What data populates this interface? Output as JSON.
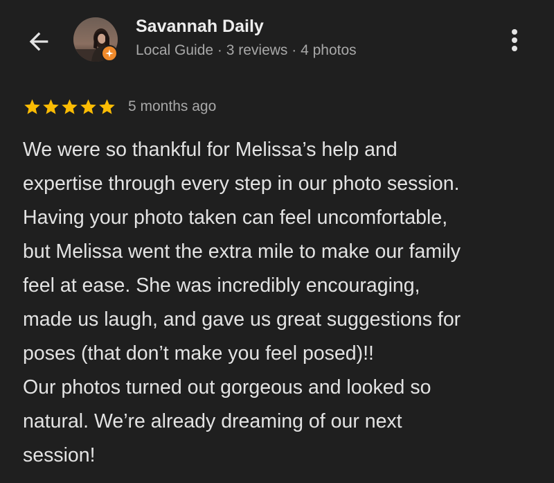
{
  "header": {
    "user_name": "Savannah Daily",
    "user_meta": "Local Guide · 3 reviews · 4 photos",
    "back_icon": "arrow-left-icon",
    "more_icon": "more-vertical-icon",
    "badge_icon": "local-guide-star-icon",
    "badge_color": "#f08a2b"
  },
  "review": {
    "rating": 5,
    "rating_max": 5,
    "star_color": "#fbbc04",
    "time_ago": "5 months ago",
    "lines": [
      "We were so thankful for Melissa’s help and",
      "expertise through every step in our photo session.",
      "Having your photo taken can feel uncomfortable,",
      "but Melissa went the extra mile to make our family",
      "feel at ease. She was incredibly encouraging,",
      "made us laugh, and gave us great suggestions for",
      "poses (that don’t make you feel posed)!!",
      "Our photos turned out gorgeous and looked so",
      "natural. We’re already dreaming of our next",
      "session!"
    ]
  },
  "colors": {
    "background": "#1f1f1f",
    "text_primary": "#e3e3e3",
    "text_secondary": "#a8a8a8"
  }
}
